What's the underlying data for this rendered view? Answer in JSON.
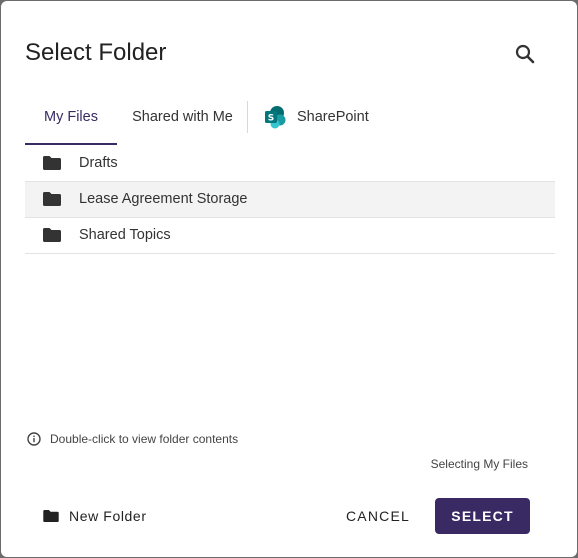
{
  "dialog": {
    "title": "Select Folder"
  },
  "tabs": [
    {
      "label": "My Files",
      "active": true
    },
    {
      "label": "Shared with Me",
      "active": false
    },
    {
      "label": "SharePoint",
      "active": false,
      "icon": "sharepoint-icon"
    }
  ],
  "folders": [
    {
      "label": "Drafts",
      "icon": "folder-icon",
      "selected": false
    },
    {
      "label": "Lease Agreement Storage",
      "icon": "folder-icon",
      "selected": true
    },
    {
      "label": "Shared Topics",
      "icon": "folder-icon",
      "selected": false
    }
  ],
  "hint": {
    "text": "Double-click to view folder contents",
    "icon": "info-icon"
  },
  "status": {
    "text": "Selecting My Files"
  },
  "footer": {
    "new_folder_label": "New Folder",
    "cancel_label": "CANCEL",
    "select_label": "SELECT"
  },
  "colors": {
    "accent": "#3a2a63",
    "sharepoint_teal": "#038387",
    "row_selected_bg": "#f3f3f4"
  }
}
